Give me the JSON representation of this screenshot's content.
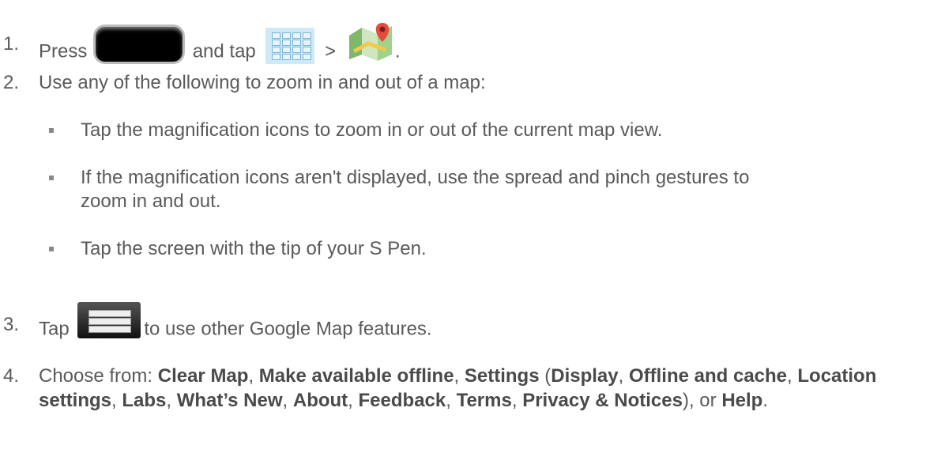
{
  "steps": [
    {
      "num": "1.",
      "t1": "Press",
      "t2": "and tap",
      "t3": ">",
      "t4": "."
    },
    {
      "num": "2.",
      "text": "Use any of the following to zoom in and out of a map:"
    },
    {
      "num": "3.",
      "t1": "Tap",
      "t2": "to use other Google Map features."
    },
    {
      "num": "4.",
      "prefix": "Choose from: ",
      "items": [
        "Clear Map",
        "Make available offline",
        "Settings",
        "Display",
        "Offline and cache",
        "Location settings",
        "Labs",
        "What’s New",
        "About",
        "Feedback",
        "Terms",
        "Privacy & Notices",
        "Help"
      ],
      "seps": [
        ", ",
        ", ",
        " (",
        ", ",
        ", ",
        ", ",
        ", ",
        ", ",
        ", ",
        ", ",
        ", ",
        "), or ",
        "."
      ]
    }
  ],
  "bullets": [
    "Tap the magnification icons to zoom in or out of the current map view.",
    "If the magnification icons aren't displayed, use the spread and pinch gestures to",
    "zoom in and out.",
    "Tap the screen with the tip of your S Pen."
  ],
  "icons": [
    "home-key-icon",
    "applications-icon",
    "maps-app-icon",
    "menu-key-icon"
  ]
}
